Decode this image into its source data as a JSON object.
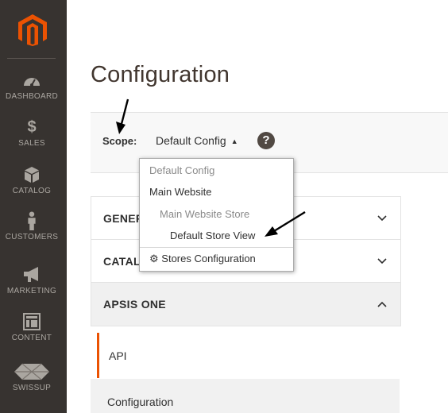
{
  "sidebar": {
    "items": [
      {
        "label": "DASHBOARD",
        "icon": "speedometer-icon"
      },
      {
        "label": "SALES",
        "icon": "dollar-icon"
      },
      {
        "label": "CATALOG",
        "icon": "box-icon"
      },
      {
        "label": "CUSTOMERS",
        "icon": "person-icon"
      },
      {
        "label": "MARKETING",
        "icon": "megaphone-icon"
      },
      {
        "label": "CONTENT",
        "icon": "layout-icon"
      },
      {
        "label": "SWISSUP",
        "icon": "swissup-logo-icon"
      }
    ]
  },
  "page": {
    "title": "Configuration"
  },
  "scope": {
    "label": "Scope:",
    "current": "Default Config",
    "help": "?",
    "options": [
      {
        "label": "Default Config",
        "state": "disabled"
      },
      {
        "label": "Main Website",
        "state": "enabled"
      },
      {
        "label": "Main Website Store",
        "state": "disabled"
      },
      {
        "label": "Default Store View",
        "state": "enabled"
      }
    ],
    "stores_link": "Stores Configuration"
  },
  "sections": [
    {
      "title": "GENERAL",
      "expanded": false
    },
    {
      "title": "CATALOG",
      "expanded": false
    },
    {
      "title": "APSIS ONE",
      "expanded": true
    }
  ],
  "subtabs": {
    "api": "API",
    "configuration": "Configuration"
  },
  "colors": {
    "sidebar_bg": "#373330",
    "brand": "#eb5202",
    "active_tab_border": "#eb5202"
  }
}
